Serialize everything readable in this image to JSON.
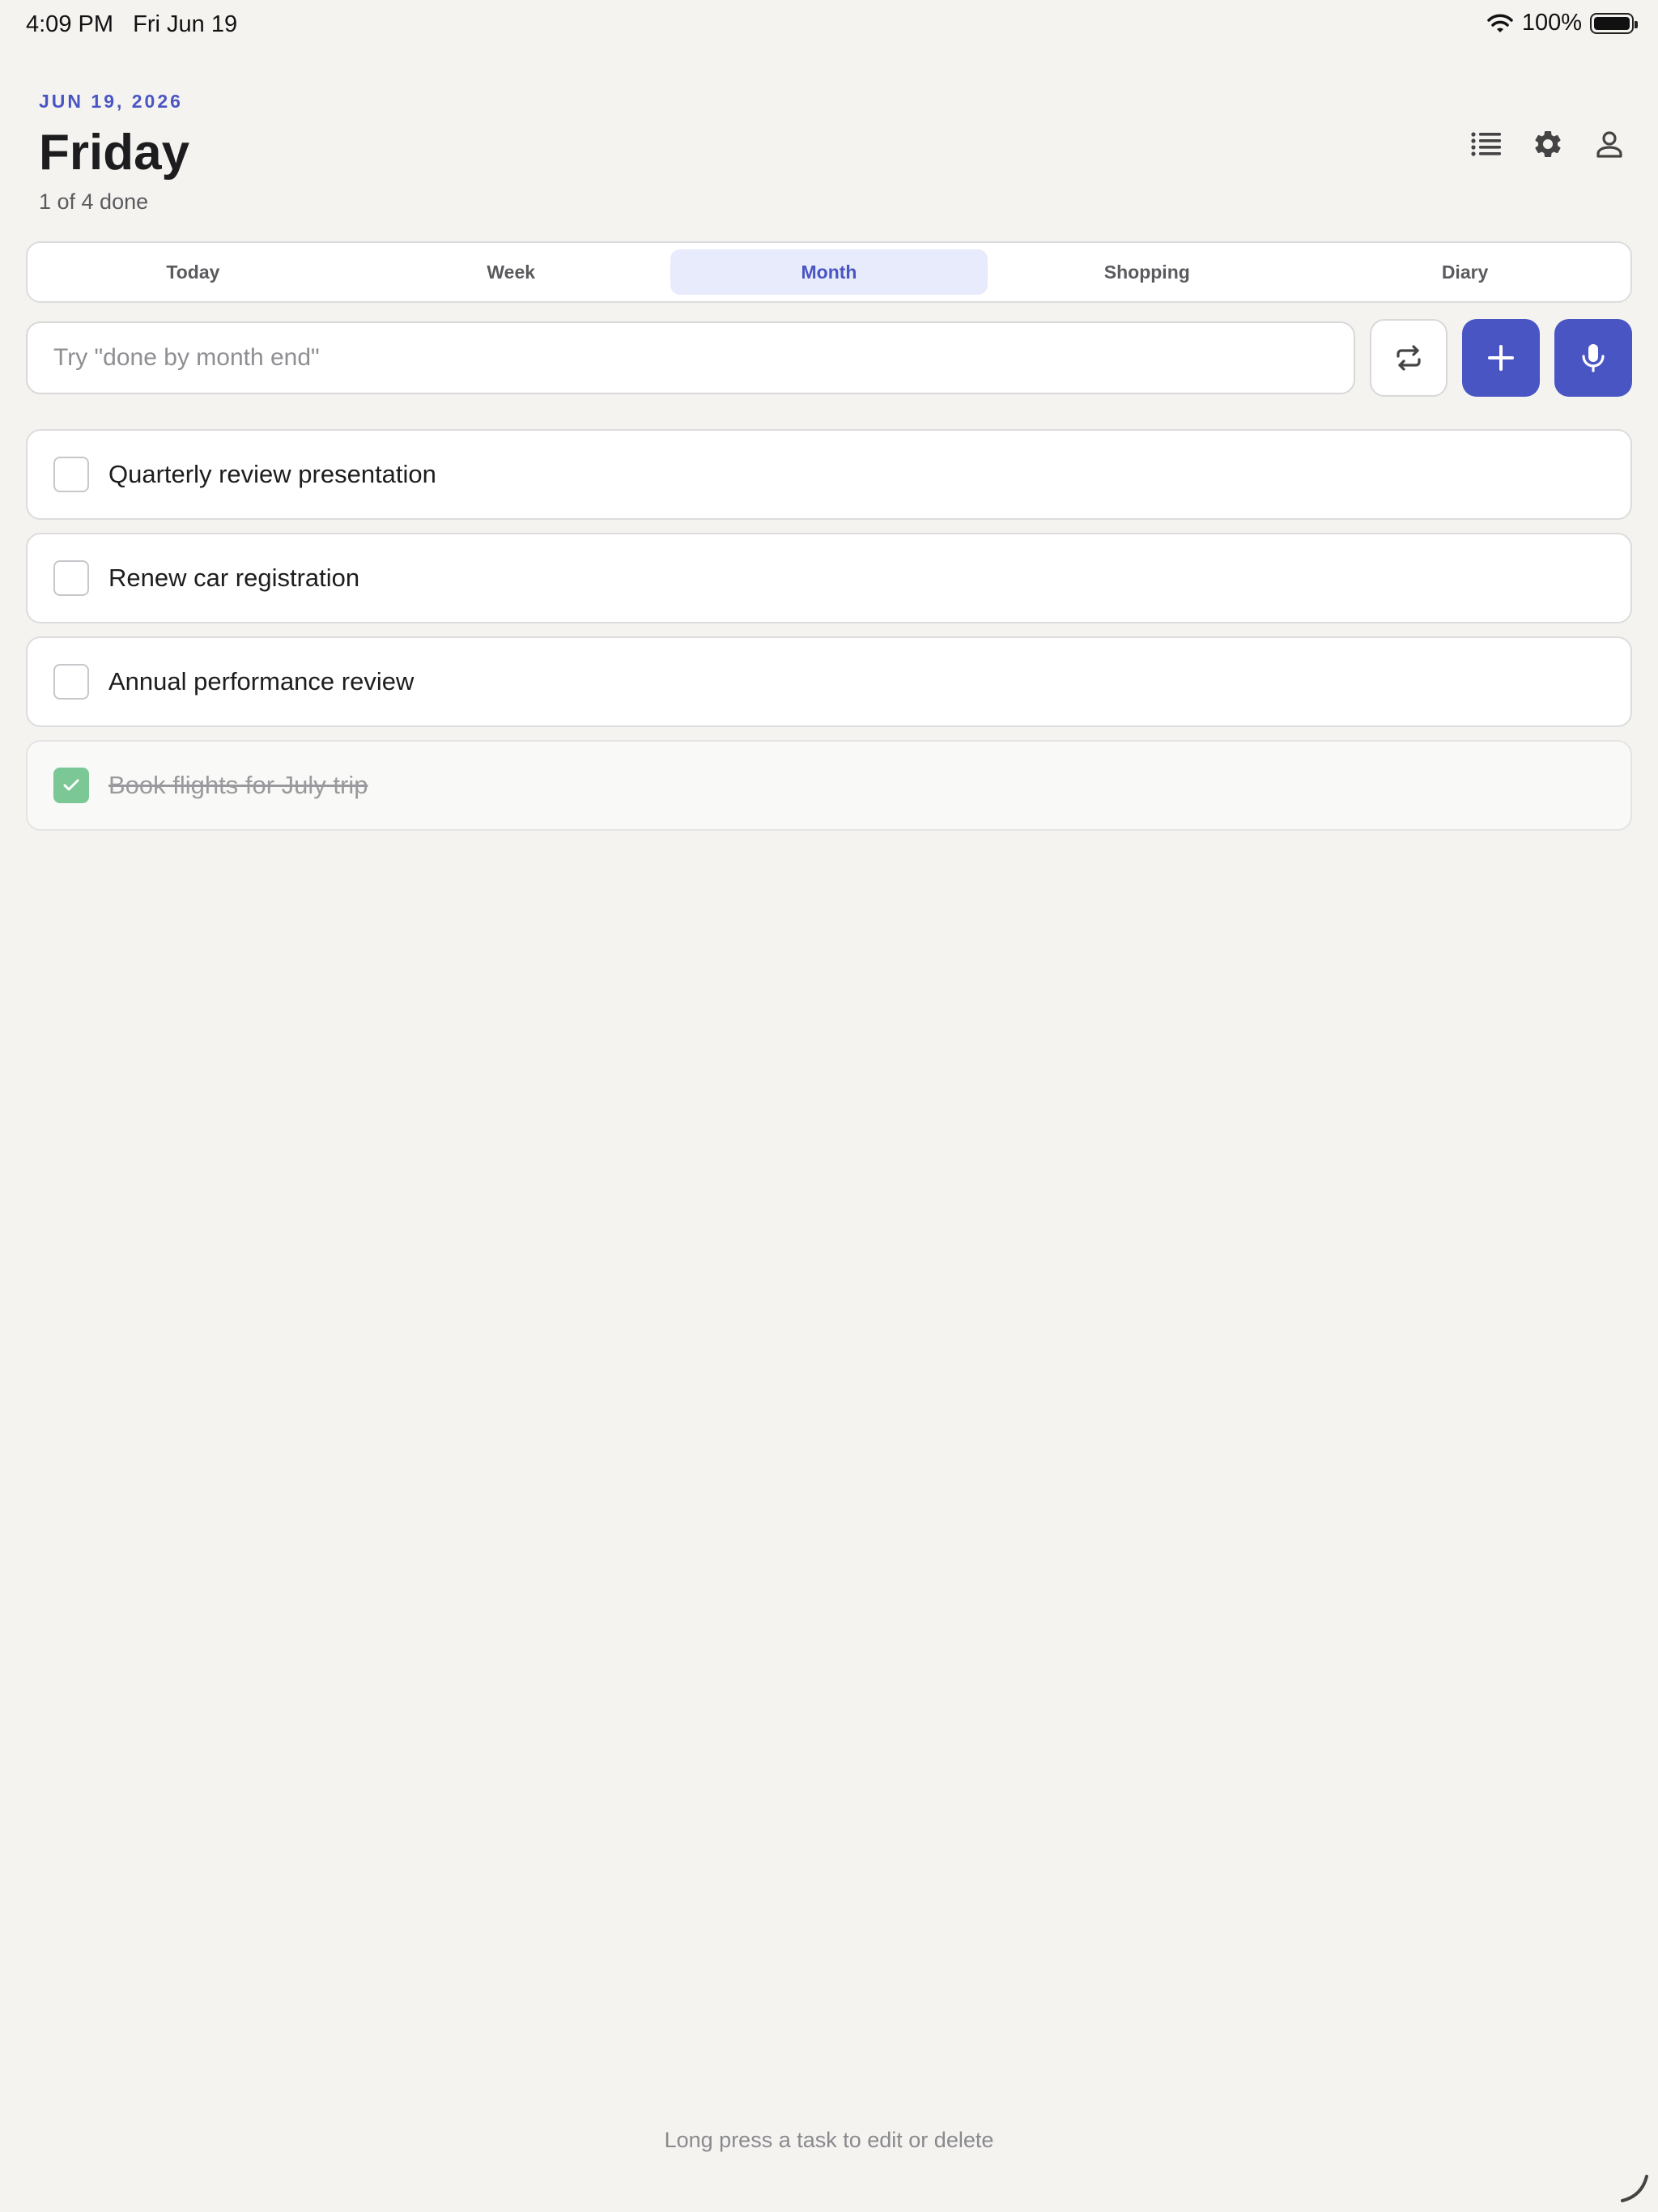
{
  "status_bar": {
    "time": "4:09 PM",
    "date": "Fri Jun 19",
    "battery": "100%",
    "icons": [
      "wifi-icon",
      "battery-icon"
    ]
  },
  "header": {
    "date_caption": "JUN 19, 2026",
    "day": "Friday",
    "progress": "1 of 4 done",
    "actions": [
      "list-icon",
      "gear-icon",
      "person-icon"
    ]
  },
  "tabs": [
    {
      "label": "Today",
      "active": false
    },
    {
      "label": "Week",
      "active": false
    },
    {
      "label": "Month",
      "active": true
    },
    {
      "label": "Shopping",
      "active": false
    },
    {
      "label": "Diary",
      "active": false
    }
  ],
  "input": {
    "placeholder": "Try \"done by month end\"",
    "value": ""
  },
  "buttons": [
    "repeat-icon",
    "plus-icon",
    "microphone-icon"
  ],
  "tasks": [
    {
      "label": "Quarterly review presentation",
      "done": false
    },
    {
      "label": "Renew car registration",
      "done": false
    },
    {
      "label": "Annual performance review",
      "done": false
    },
    {
      "label": "Book flights for July trip",
      "done": true
    }
  ],
  "footer_hint": "Long press a task to edit or delete",
  "colors": {
    "accent": "#4a55c4",
    "active_tab_bg": "#e7ebfb",
    "done_check": "#7bc896",
    "background": "#f4f3f0"
  }
}
